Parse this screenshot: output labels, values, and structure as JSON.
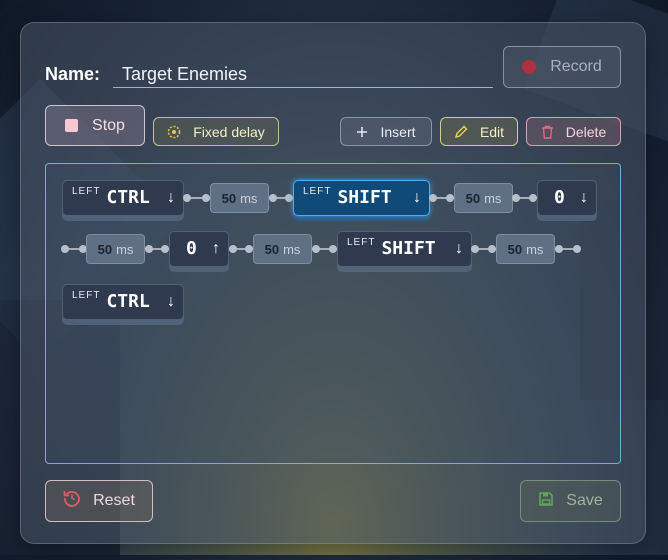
{
  "macro": {
    "name_label": "Name:",
    "name_value": "Target Enemies"
  },
  "toolbar": {
    "record_label": "Record",
    "stop_label": "Stop",
    "fixed_delay_label": "Fixed delay",
    "insert_label": "Insert",
    "edit_label": "Edit",
    "delete_label": "Delete"
  },
  "sequence": [
    {
      "kind": "key",
      "sub": "LEFT",
      "key": "CTRL",
      "direction": "down",
      "arrow": "↓"
    },
    {
      "kind": "delay",
      "value": "50",
      "unit": "ms"
    },
    {
      "kind": "key",
      "sub": "LEFT",
      "key": "SHIFT",
      "direction": "down",
      "arrow": "↓",
      "selected": true
    },
    {
      "kind": "delay",
      "value": "50",
      "unit": "ms"
    },
    {
      "kind": "key",
      "sub": "",
      "key": "0",
      "direction": "down",
      "arrow": "↓"
    },
    {
      "kind": "delay",
      "value": "50",
      "unit": "ms"
    },
    {
      "kind": "key",
      "sub": "",
      "key": "0",
      "direction": "up",
      "arrow": "↑"
    },
    {
      "kind": "delay",
      "value": "50",
      "unit": "ms"
    },
    {
      "kind": "key",
      "sub": "LEFT",
      "key": "SHIFT",
      "direction": "down",
      "arrow": "↓"
    },
    {
      "kind": "delay",
      "value": "50",
      "unit": "ms"
    },
    {
      "kind": "key",
      "sub": "LEFT",
      "key": "CTRL",
      "direction": "down",
      "arrow": "↓"
    }
  ],
  "footer": {
    "reset_label": "Reset",
    "save_label": "Save"
  },
  "icons": {
    "record": "record-dot-icon",
    "stop": "stop-square-icon",
    "fixed_delay": "timer-icon",
    "insert": "plus-icon",
    "edit": "pencil-icon",
    "delete": "trash-icon",
    "reset": "reset-icon",
    "save": "save-disk-icon"
  },
  "colors": {
    "accent_selected": "#3fb4f0",
    "record": "#b0303f",
    "reset_icon": "#e05a6a",
    "save_icon": "#5fa85a"
  }
}
